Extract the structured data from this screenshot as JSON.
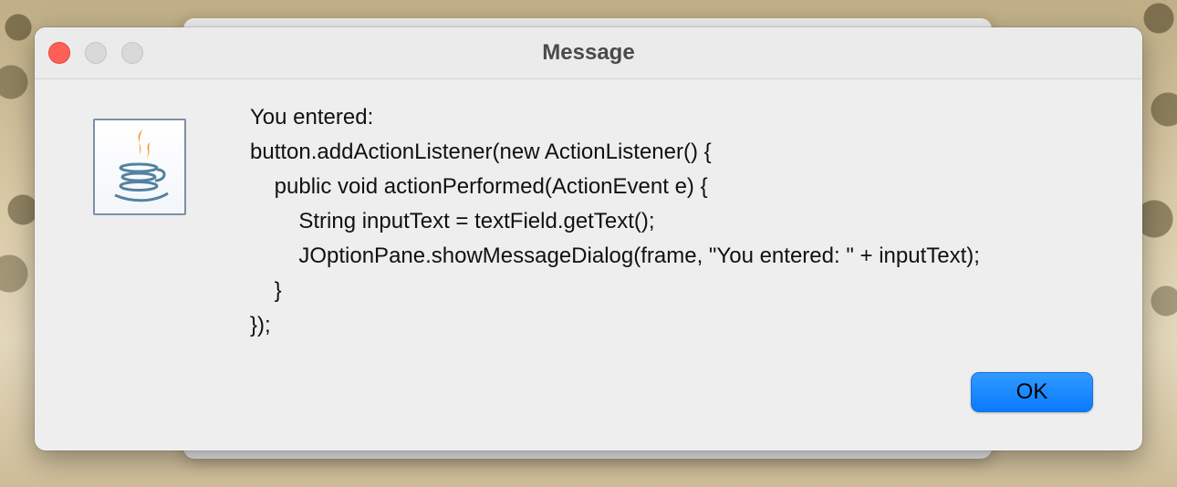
{
  "window": {
    "title": "Message"
  },
  "message": {
    "lines": [
      "You entered:",
      "button.addActionListener(new ActionListener() {",
      "    public void actionPerformed(ActionEvent e) {",
      "        String inputText = textField.getText();",
      "        JOptionPane.showMessageDialog(frame, \"You entered: \" + inputText);",
      "    }",
      "});"
    ]
  },
  "buttons": {
    "ok_label": "OK"
  },
  "icons": {
    "dialog_icon": "java-coffee-cup-icon"
  },
  "colors": {
    "accent": "#0a7aff",
    "close_button": "#ff5f57",
    "inactive_button": "#d9d9d9",
    "java_blue": "#5382a1",
    "java_orange": "#f89820"
  }
}
